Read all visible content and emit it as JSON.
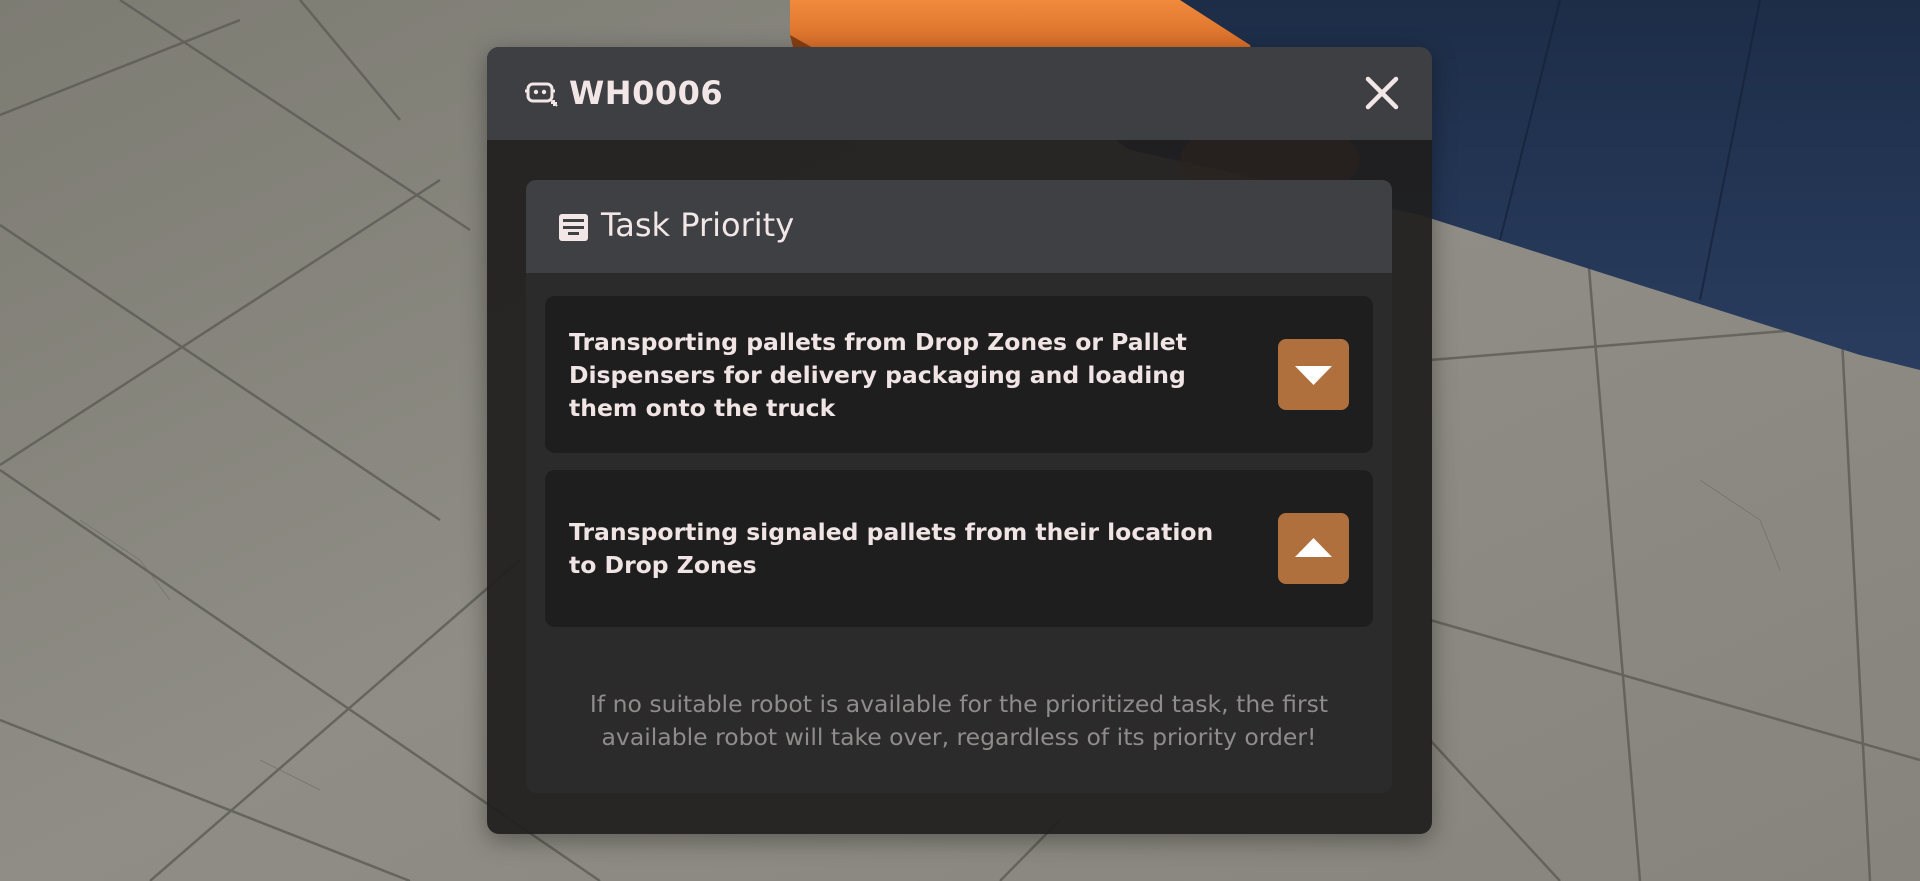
{
  "dialog": {
    "title": "WH0006",
    "title_icon": "robot-icon",
    "close_icon": "close-icon"
  },
  "panel": {
    "title": "Task Priority",
    "title_icon": "list-icon",
    "tasks": [
      {
        "text": "Transporting pallets from Drop Zones or Pallet Dispensers for delivery packaging and loading them onto the truck",
        "action_icon": "chevron-down-icon"
      },
      {
        "text": "Transporting signaled pallets from their location to Drop Zones",
        "action_icon": "chevron-up-icon"
      }
    ],
    "footnote": "If no suitable robot is available for the prioritized task, the first available robot will take over, regardless of its priority order!"
  },
  "colors": {
    "accent_button": "#b0703e",
    "header_bg": "#3d3f42",
    "modal_bg": "#1f1e1d",
    "text_primary": "#f2e6e6",
    "text_muted": "#8f8c8b"
  }
}
